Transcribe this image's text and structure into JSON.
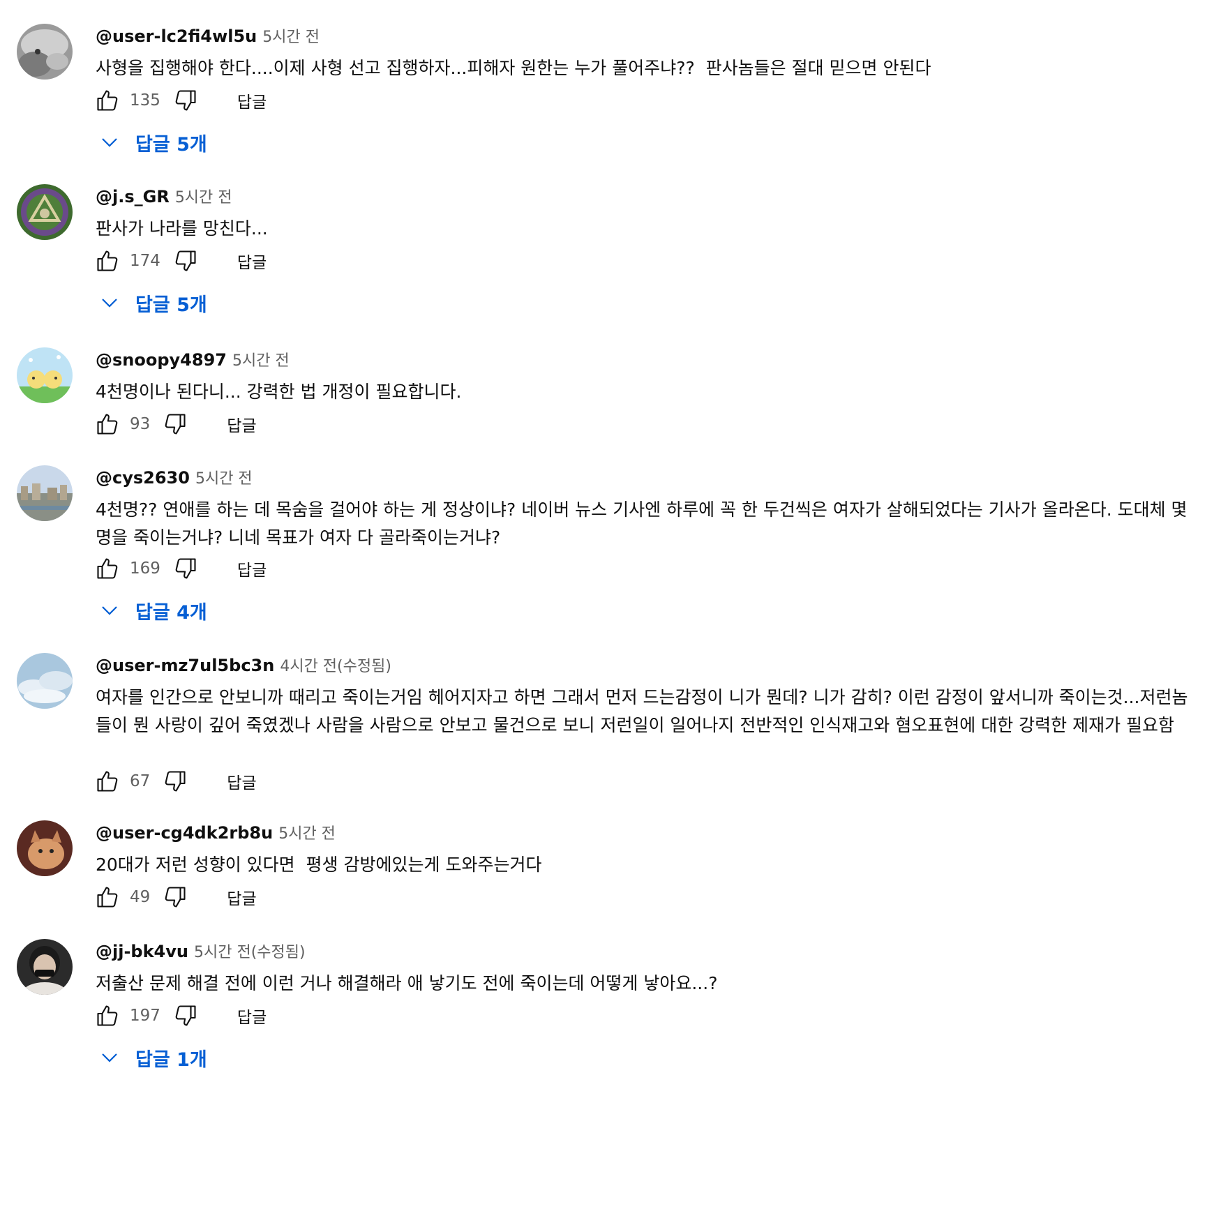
{
  "reply_label": "답글",
  "colors": {
    "link_blue": "#065fd4",
    "secondary_text": "#606060",
    "primary_text": "#0f0f0f"
  },
  "comments": [
    {
      "handle": "@user-lc2fi4wl5u",
      "time": "5시간 전",
      "text": "사형을 집행해야 한다....이제 사형 선고 집행하자...피해자 원한는 누가 풀어주냐??  판사놈들은 절대 믿으면 안된다",
      "likes": "135",
      "replies": "답글 5개",
      "avatar": "dog-photo"
    },
    {
      "handle": "@j.s_GR",
      "time": "5시간 전",
      "text": "판사가 나라를 망친다...",
      "likes": "174",
      "replies": "답글 5개",
      "avatar": "emblem"
    },
    {
      "handle": "@snoopy4897",
      "time": "5시간 전",
      "text": "4천명이나 된다니... 강력한 법 개정이 필요합니다.",
      "likes": "93",
      "replies": null,
      "avatar": "cartoon-chicks"
    },
    {
      "handle": "@cys2630",
      "time": "5시간 전",
      "text": "4천명?? 연애를 하는 데 목숨을 걸어야 하는 게 정상이냐? 네이버 뉴스 기사엔 하루에 꼭 한 두건씩은 여자가 살해되었다는 기사가 올라온다. 도대체 몇 명을 죽이는거냐? 니네 목표가 여자 다 골라죽이는거냐?",
      "likes": "169",
      "replies": "답글 4개",
      "avatar": "city-view"
    },
    {
      "handle": "@user-mz7ul5bc3n",
      "time": "4시간 전(수정됨)",
      "text": "여자를 인간으로 안보니까 때리고 죽이는거임 헤어지자고 하면 그래서 먼저 드는감정이 니가 뭔데? 니가 감히? 이런 감정이 앞서니까 죽이는것...저런놈들이 뭔 사랑이 깊어 죽였겠나 사람을 사람으로 안보고 물건으로 보니 저런일이 일어나지 전반적인 인식재고와 혐오표현에 대한 강력한 제재가 필요함",
      "likes": "67",
      "replies": null,
      "avatar": "sky-clouds"
    },
    {
      "handle": "@user-cg4dk2rb8u",
      "time": "5시간 전",
      "text": "20대가 저런 성향이 있다면  평생 감방에있는게 도와주는거다",
      "likes": "49",
      "replies": null,
      "avatar": "cat-photo"
    },
    {
      "handle": "@jj-bk4vu",
      "time": "5시간 전(수정됨)",
      "text": "저출산 문제 해결 전에 이런 거나 해결해라 애 낳기도 전에 죽이는데 어떻게 낳아요...?",
      "likes": "197",
      "replies": "답글 1개",
      "avatar": "person-photo"
    }
  ]
}
